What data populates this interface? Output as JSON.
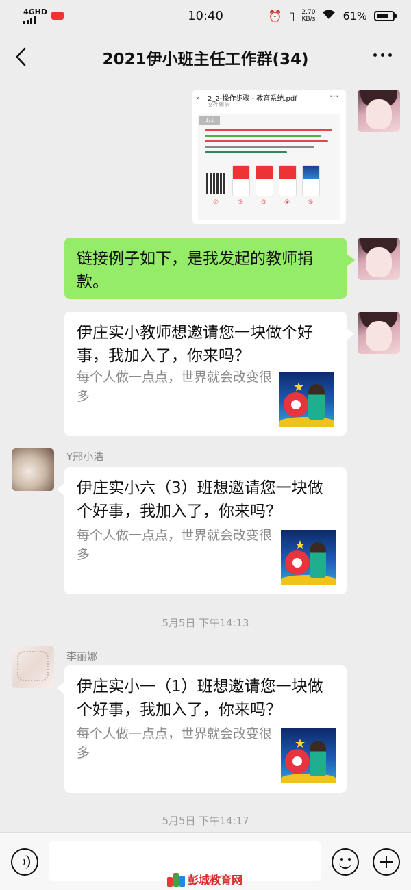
{
  "status_bar": {
    "network": "4GHD",
    "time": "10:40",
    "speed_value": "2.70",
    "speed_unit": "KB/s",
    "battery": "61%"
  },
  "header": {
    "title": "2021伊小班主任工作群(34)"
  },
  "messages": {
    "file": {
      "name": "2_2-操作步骤 - 教育系统.pdf",
      "subtitle": "文件预览",
      "page_badge": "1/1",
      "steps": [
        "①",
        "②",
        "③",
        "④",
        "⑤"
      ]
    },
    "text1": "链接例子如下，是我发起的教师捐款。",
    "card1": {
      "title": "伊庄实小教师想邀请您一块做个好事，我加入了，你来吗？",
      "desc": "每个人做一点点，世界就会改变很多"
    },
    "card2": {
      "sender": "Y邢小浩",
      "title": "伊庄实小六（3）班想邀请您一块做个好事，我加入了，你来吗？",
      "desc": "每个人做一点点，世界就会改变很多"
    },
    "time1": "5月5日 下午14:13",
    "card3": {
      "sender": "李丽娜",
      "title": "伊庄实小一（1）班想邀请您一块做个好事，我加入了，你来吗？",
      "desc": "每个人做一点点，世界就会改变很多"
    },
    "time2": "5月5日 下午14:17"
  },
  "watermark": "彭城教育网",
  "colors": {
    "background": "#ededed",
    "my_bubble": "#95ec69",
    "other_bubble": "#ffffff",
    "timestamp": "#999999"
  }
}
